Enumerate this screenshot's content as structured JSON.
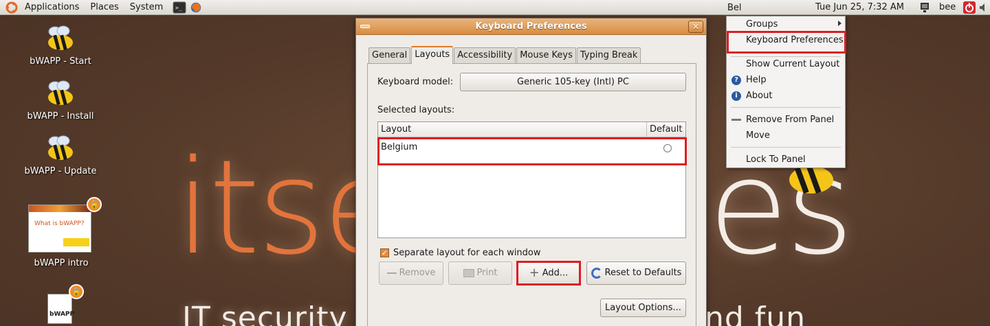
{
  "panel": {
    "menus": [
      "Applications",
      "Places",
      "System"
    ],
    "layout_indicator": "Bel",
    "clock": "Tue Jun 25,  7:32 AM",
    "user": "bee"
  },
  "desktop": {
    "icons": [
      {
        "label": "bWAPP - Start"
      },
      {
        "label": "bWAPP - Install"
      },
      {
        "label": "bWAPP - Update"
      },
      {
        "label": "bWAPP intro"
      },
      {
        "label": "bWAPP"
      }
    ],
    "thumb_text": "What is bWAPP?",
    "wallpaper_left": "itse",
    "wallpaper_right": "es",
    "wallpaper_sub_left": "IT security  e",
    "wallpaper_sub_right": "nd fun"
  },
  "dialog": {
    "title": "Keyboard Preferences",
    "tabs": [
      "General",
      "Layouts",
      "Accessibility",
      "Mouse Keys",
      "Typing Break"
    ],
    "model_label": "Keyboard model:",
    "model_value": "Generic 105-key (Intl) PC",
    "selected_label": "Selected layouts:",
    "col_layout": "Layout",
    "col_default": "Default",
    "layouts": [
      "Belgium"
    ],
    "separate_label": "Separate layout for each window",
    "btn_remove": "Remove",
    "btn_print": "Print",
    "btn_add": "Add...",
    "btn_reset": "Reset to Defaults",
    "btn_options": "Layout Options..."
  },
  "popup_menu": {
    "groups": "Groups",
    "keyboard_prefs": "Keyboard Preferences",
    "show_layout": "Show Current Layout",
    "help": "Help",
    "about": "About",
    "remove_panel": "Remove From Panel",
    "move": "Move",
    "lock": "Lock To Panel"
  },
  "colors": {
    "highlight": "#dd1c24",
    "accent": "#e07a2a",
    "desktop": "#553a2a"
  }
}
